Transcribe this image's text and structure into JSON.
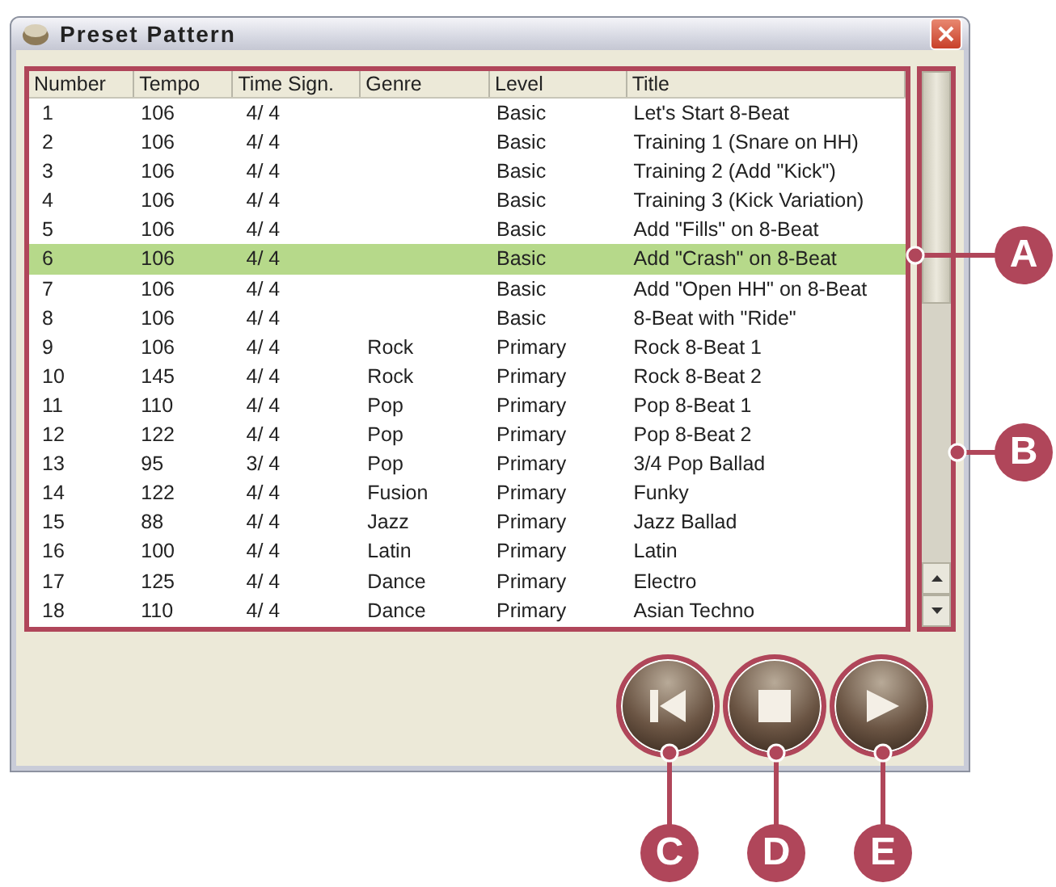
{
  "window": {
    "title": "Preset Pattern"
  },
  "table": {
    "columns": [
      "Number",
      "Tempo",
      "Time Sign.",
      "Genre",
      "Level",
      "Title"
    ],
    "rows": [
      {
        "cells": [
          "1",
          "106",
          "4/ 4",
          "",
          "Basic",
          "Let's Start 8-Beat"
        ],
        "selected": false
      },
      {
        "cells": [
          "2",
          "106",
          "4/ 4",
          "",
          "Basic",
          "Training 1 (Snare on HH)"
        ],
        "selected": false
      },
      {
        "cells": [
          "3",
          "106",
          "4/ 4",
          "",
          "Basic",
          "Training 2 (Add \"Kick\")"
        ],
        "selected": false
      },
      {
        "cells": [
          "4",
          "106",
          "4/ 4",
          "",
          "Basic",
          "Training 3 (Kick Variation)"
        ],
        "selected": false
      },
      {
        "cells": [
          "5",
          "106",
          "4/ 4",
          "",
          "Basic",
          "Add \"Fills\" on 8-Beat"
        ],
        "selected": false
      },
      {
        "cells": [
          "6",
          "106",
          "4/ 4",
          "",
          "Basic",
          "Add \"Crash\" on 8-Beat"
        ],
        "selected": true
      },
      {
        "cells": [
          "7",
          "106",
          "4/ 4",
          "",
          "Basic",
          "Add \"Open HH\" on 8-Beat"
        ],
        "selected": false
      },
      {
        "cells": [
          "8",
          "106",
          "4/ 4",
          "",
          "Basic",
          "8-Beat with \"Ride\""
        ],
        "selected": false
      },
      {
        "cells": [
          "9",
          "106",
          "4/ 4",
          "Rock",
          "Primary",
          "Rock 8-Beat 1"
        ],
        "selected": false
      },
      {
        "cells": [
          "10",
          "145",
          "4/ 4",
          "Rock",
          "Primary",
          "Rock 8-Beat 2"
        ],
        "selected": false
      },
      {
        "cells": [
          "11",
          "110",
          "4/ 4",
          "Pop",
          "Primary",
          "Pop 8-Beat 1"
        ],
        "selected": false
      },
      {
        "cells": [
          "12",
          "122",
          "4/ 4",
          "Pop",
          "Primary",
          "Pop 8-Beat 2"
        ],
        "selected": false
      },
      {
        "cells": [
          "13",
          "95",
          "3/ 4",
          "Pop",
          "Primary",
          "3/4 Pop Ballad"
        ],
        "selected": false
      },
      {
        "cells": [
          "14",
          "122",
          "4/ 4",
          "Fusion",
          "Primary",
          "Funky"
        ],
        "selected": false
      },
      {
        "cells": [
          "15",
          "88",
          "4/ 4",
          "Jazz",
          "Primary",
          "Jazz Ballad"
        ],
        "selected": false
      },
      {
        "cells": [
          "16",
          "100",
          "4/ 4",
          "Latin",
          "Primary",
          "Latin"
        ],
        "selected": false
      },
      {
        "cells": [
          "17",
          "125",
          "4/ 4",
          "Dance",
          "Primary",
          "Electro"
        ],
        "selected": false
      },
      {
        "cells": [
          "18",
          "110",
          "4/ 4",
          "Dance",
          "Primary",
          "Asian Techno"
        ],
        "selected": false
      }
    ]
  },
  "transport": [
    {
      "kind": "previous"
    },
    {
      "kind": "stop"
    },
    {
      "kind": "play"
    }
  ],
  "callouts": [
    {
      "label": "A",
      "kind": "table"
    },
    {
      "label": "B",
      "kind": "scrollbar"
    },
    {
      "label": "C",
      "kind": "previous"
    },
    {
      "label": "D",
      "kind": "stop"
    },
    {
      "label": "E",
      "kind": "play"
    }
  ]
}
